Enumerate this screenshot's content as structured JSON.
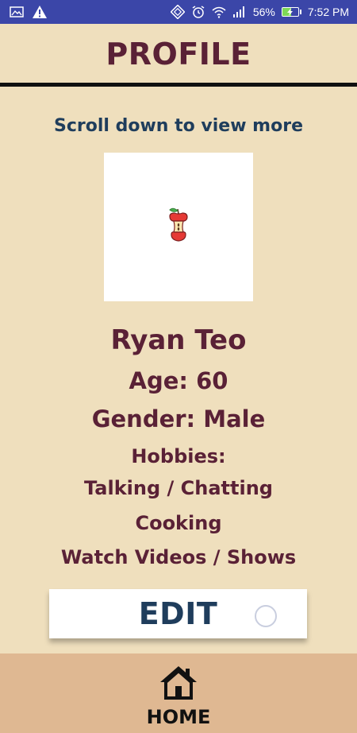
{
  "status_bar": {
    "battery_percent": "56%",
    "time": "7:52 PM",
    "battery_level": 0.56,
    "icons": [
      "image-icon",
      "warning-icon",
      "nfc-icon",
      "alarm-icon",
      "wifi-icon",
      "signal-icon",
      "battery-charging-icon"
    ]
  },
  "header": {
    "title": "PROFILE"
  },
  "profile": {
    "scroll_hint": "Scroll down to view more",
    "avatar_icon": "apple-core-icon",
    "name": "Ryan Teo",
    "age": "Age: 60",
    "gender": "Gender: Male",
    "hobbies_label": "Hobbies:",
    "hobbies": [
      "Talking / Chatting",
      "Cooking",
      "Watch Videos / Shows"
    ]
  },
  "edit_button": {
    "label": "EDIT"
  },
  "bottom_nav": {
    "home_label": "HOME",
    "home_icon": "home-icon"
  },
  "colors": {
    "background": "#efdfbd",
    "status_bar": "#3b46a8",
    "title_text": "#5a2136",
    "accent_text": "#1f3d5c",
    "bottom_nav": "#dfb892"
  }
}
